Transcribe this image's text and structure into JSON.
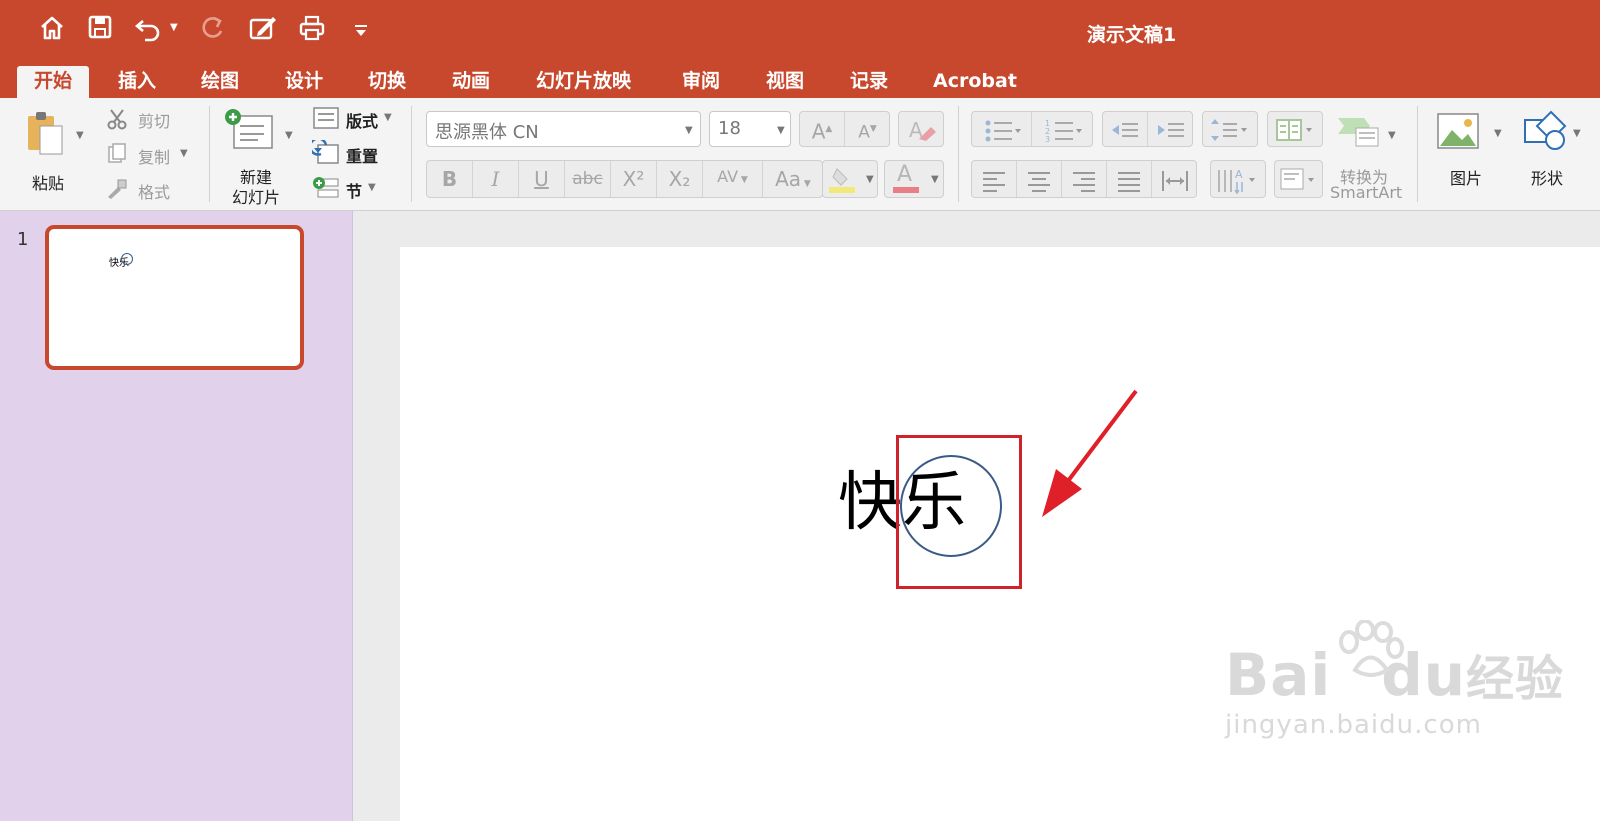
{
  "window": {
    "title": "演示文稿1"
  },
  "quick_access": [
    {
      "icon": "home-icon"
    },
    {
      "icon": "save-icon"
    },
    {
      "icon": "undo-icon"
    },
    {
      "icon": "redo-icon"
    },
    {
      "icon": "edit-doc-icon"
    },
    {
      "icon": "print-icon"
    },
    {
      "icon": "customize-caret-icon"
    }
  ],
  "tabs": [
    "开始",
    "插入",
    "绘图",
    "设计",
    "切换",
    "动画",
    "幻灯片放映",
    "审阅",
    "视图",
    "记录",
    "Acrobat"
  ],
  "active_tab": "开始",
  "ribbon": {
    "paste_label": "粘贴",
    "cut_label": "剪切",
    "copy_label": "复制",
    "format_label": "格式",
    "new_slide_label_1": "新建",
    "new_slide_label_2": "幻灯片",
    "layout_label": "版式",
    "reset_label": "重置",
    "section_label": "节",
    "font_name": "思源黑体 CN",
    "font_size": "18",
    "bold": "B",
    "italic": "I",
    "underline": "U",
    "strikethrough": "abc",
    "superscript": "X²",
    "subscript": "X₂",
    "char_spacing": "AV",
    "change_case": "Aa",
    "font_color_glyph": "A",
    "grow_font": "A",
    "shrink_font": "A",
    "smartart_label_1": "转换为",
    "smartart_label_2": "SmartArt",
    "picture_label": "图片",
    "shape_label": "形状"
  },
  "colors": {
    "accent": "#c7482c",
    "panel": "#e2d1ea",
    "highlight_box": "#d0222b",
    "circle": "#3b5a86"
  },
  "slides": [
    {
      "number": "1",
      "thumb_text": "快乐"
    }
  ],
  "slide": {
    "text_1": "快",
    "text_2": "乐"
  },
  "watermark": {
    "line1": "Bai",
    "line2": "du",
    "line3": "经验",
    "url": "jingyan.baidu.com"
  }
}
